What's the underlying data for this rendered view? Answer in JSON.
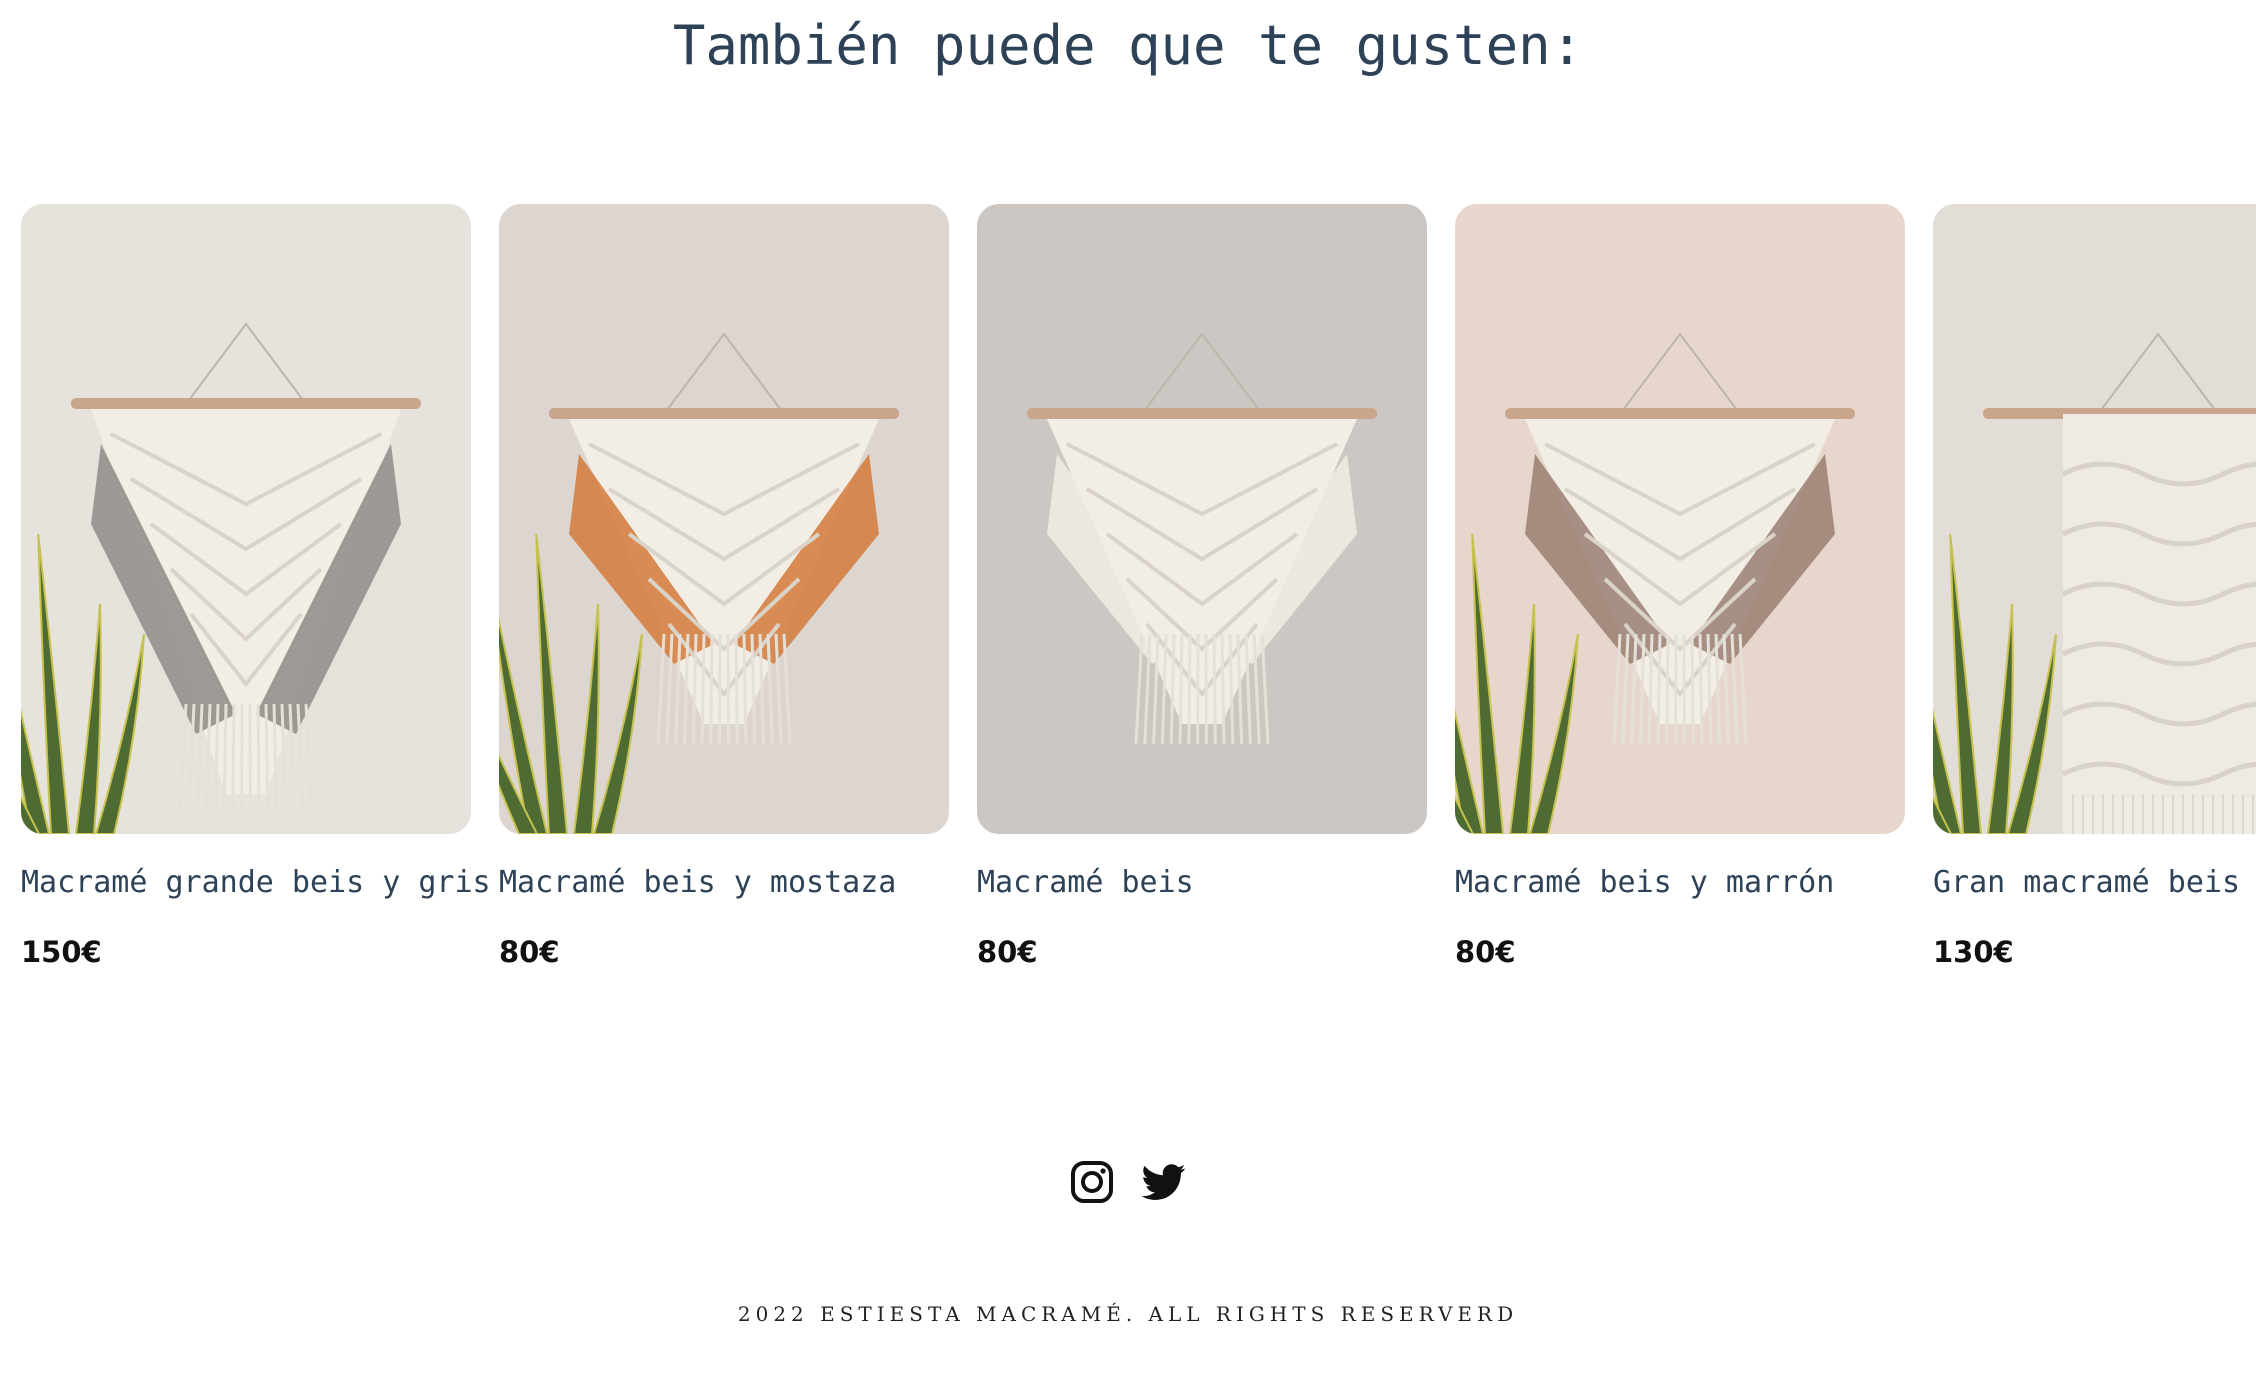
{
  "section": {
    "title": "También puede que te gusten:"
  },
  "products": [
    {
      "name": "Macramé grande beis y gris",
      "price": "150€",
      "wall": "#e6e2dc",
      "accent": "#8e8b87",
      "plant": true
    },
    {
      "name": "Macramé beis y mostaza",
      "price": "80€",
      "wall": "#ddd5d0",
      "accent": "#d47a3a",
      "plant": true
    },
    {
      "name": "Macramé beis",
      "price": "80€",
      "wall": "#cdc7c3",
      "accent": "#f1ede5",
      "plant": false
    },
    {
      "name": "Macramé beis y marrón",
      "price": "80€",
      "wall": "#e7d6cb",
      "accent": "#9a7f71",
      "plant": true
    },
    {
      "name": "Gran macramé beis y blanco",
      "price": "130€",
      "wall": "#e2ddd6",
      "accent": "#f1ede5",
      "plant": true
    }
  ],
  "social": {
    "instagram_icon": "instagram-icon",
    "twitter_icon": "twitter-icon"
  },
  "footer": {
    "text": "2022 ESTIESTA MACRAMÉ. ALL RIGHTS RESERVERD"
  }
}
